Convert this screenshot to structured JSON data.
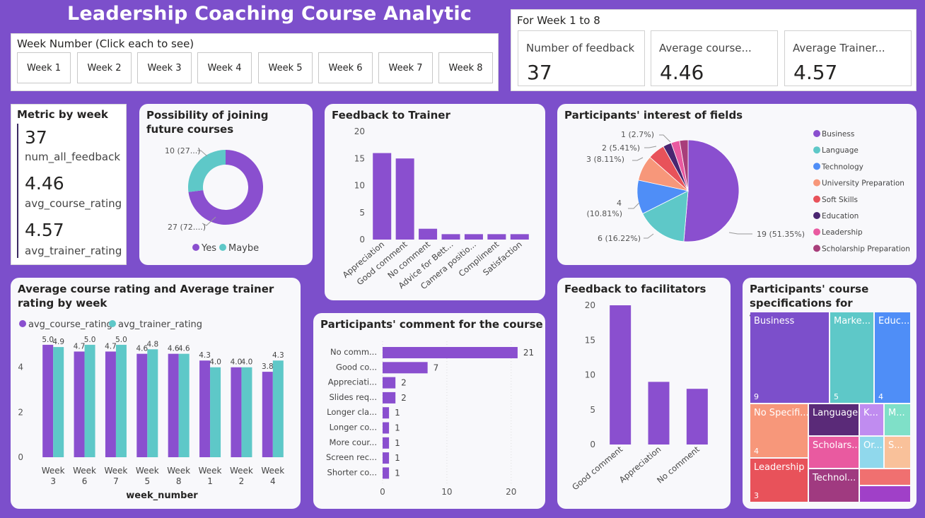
{
  "title": "Leadership Coaching Course Analytic",
  "slicer": {
    "title": "Week Number (Click each to see)",
    "weeks": [
      "Week 1",
      "Week 2",
      "Week 3",
      "Week 4",
      "Week 5",
      "Week 6",
      "Week 7",
      "Week 8"
    ]
  },
  "summary": {
    "title": "For Week 1 to 8",
    "kpis": [
      {
        "label": "Number of feedback",
        "value": "37"
      },
      {
        "label": "Average course...",
        "value": "4.46"
      },
      {
        "label": "Average Trainer...",
        "value": "4.57"
      }
    ]
  },
  "metric": {
    "title": "Metric by week",
    "items": [
      {
        "value": "37",
        "label": "num_all_feedback"
      },
      {
        "value": "4.46",
        "label": "avg_course_rating"
      },
      {
        "value": "4.57",
        "label": "avg_trainer_rating"
      }
    ]
  },
  "colors": {
    "purple": "#8a4fcf",
    "teal": "#5ec8c8",
    "blue": "#4f8ef7",
    "salmon": "#f7977a",
    "red": "#e8525a",
    "dark_purple": "#4a2570",
    "pink": "#e95aa0",
    "plum": "#a83e7a"
  },
  "chart_data": [
    {
      "id": "donut",
      "type": "pie",
      "title": "Possibility of joining future courses",
      "categories": [
        "Yes",
        "Maybe"
      ],
      "values": [
        27,
        10
      ],
      "labels": [
        "27 (72....)",
        "10 (27...)"
      ],
      "legend": [
        "Yes",
        "Maybe"
      ]
    },
    {
      "id": "trainer",
      "type": "bar",
      "title": "Feedback to Trainer",
      "categories": [
        "Appreciation",
        "Good comment",
        "No comment",
        "Advice for Bett...",
        "Camera positio...",
        "Compliment",
        "Satisfaction"
      ],
      "values": [
        16,
        15,
        2,
        1,
        1,
        1,
        1
      ],
      "ylim": [
        0,
        20
      ],
      "yticks": [
        "0",
        "5",
        "10",
        "15",
        "20"
      ]
    },
    {
      "id": "fields",
      "type": "pie",
      "title": "Participants' interest of fields",
      "categories": [
        "Business",
        "Language",
        "Technology",
        "University Preparation",
        "Soft Skills",
        "Education",
        "Leadership",
        "Scholarship Preparation"
      ],
      "values": [
        19,
        6,
        4,
        3,
        2,
        1,
        1,
        1
      ],
      "labels": [
        "19 (51.35%)",
        "6 (16.22%)",
        "4",
        "(10.81%)",
        "3 (8.11%)",
        "2 (5.41%)",
        "1 (2.7%)"
      ]
    },
    {
      "id": "ratings",
      "type": "bar",
      "title": "Average course rating and Average trainer rating by week",
      "legend": [
        "avg_course_rating",
        "avg_trainer_rating"
      ],
      "categories": [
        "Week 3",
        "Week 6",
        "Week 7",
        "Week 5",
        "Week 8",
        "Week 1",
        "Week 2",
        "Week 4"
      ],
      "series": [
        {
          "name": "avg_course_rating",
          "values": [
            5.0,
            4.7,
            4.7,
            4.6,
            4.6,
            4.3,
            4.0,
            3.8
          ]
        },
        {
          "name": "avg_trainer_rating",
          "values": [
            4.9,
            5.0,
            5.0,
            4.8,
            4.6,
            4.0,
            4.0,
            4.3
          ]
        }
      ],
      "value_labels": [
        [
          "5.0",
          "4.7",
          "4.7",
          "4.6",
          "4.6",
          "4.3",
          "4.0",
          "3.8"
        ],
        [
          "4.9",
          "5.0",
          "5.0",
          "4.8",
          "4.6",
          "4.0",
          "4.0",
          "4.3"
        ]
      ],
      "xlabel": "week_number",
      "ylim": [
        0,
        5.5
      ],
      "yticks": [
        "0",
        "2",
        "4"
      ]
    },
    {
      "id": "comments",
      "type": "bar",
      "title": "Participants' comment for the course",
      "categories": [
        "No comm...",
        "Good co...",
        "Appreciati...",
        "Slides req...",
        "Longer cla...",
        "Longer co...",
        "More cour...",
        "Screen rec...",
        "Shorter co..."
      ],
      "values": [
        21,
        7,
        2,
        2,
        1,
        1,
        1,
        1,
        1
      ],
      "xlim": [
        0,
        22
      ],
      "xticks": [
        "0",
        "10",
        "20"
      ]
    },
    {
      "id": "facilitators",
      "type": "bar",
      "title": "Feedback to facilitators",
      "categories": [
        "Good comment",
        "Appreciation",
        "No comment"
      ],
      "values": [
        20,
        9,
        8
      ],
      "ylim": [
        0,
        20
      ],
      "yticks": [
        "0",
        "5",
        "10",
        "15",
        "20"
      ]
    },
    {
      "id": "treemap",
      "type": "heatmap",
      "title": "Participants' course specifications for future",
      "tiles": [
        {
          "label": "Business",
          "value": "9"
        },
        {
          "label": "Marke...",
          "value": "5"
        },
        {
          "label": "Educ...",
          "value": "4"
        },
        {
          "label": "No Specifi...",
          "value": "4"
        },
        {
          "label": "Language",
          "value": ""
        },
        {
          "label": "K...",
          "value": ""
        },
        {
          "label": "M...",
          "value": ""
        },
        {
          "label": "Leadership",
          "value": "3"
        },
        {
          "label": "Scholars...",
          "value": ""
        },
        {
          "label": "Or...",
          "value": ""
        },
        {
          "label": "S...",
          "value": ""
        },
        {
          "label": "Technol...",
          "value": ""
        },
        {
          "label": "",
          "value": ""
        },
        {
          "label": "",
          "value": ""
        }
      ]
    }
  ]
}
